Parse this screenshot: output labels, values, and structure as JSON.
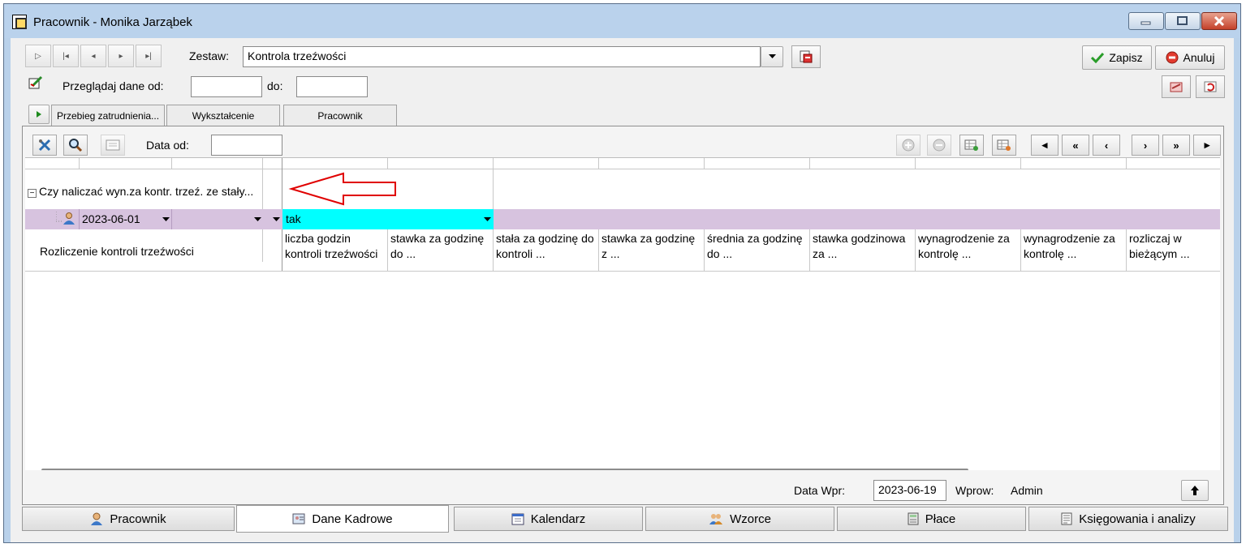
{
  "window": {
    "title": "Pracownik - Monika Jarząbek"
  },
  "toolbar": {
    "zestaw_label": "Zestaw:",
    "zestaw_value": "Kontrola trzeźwości",
    "save_label": "Zapisz",
    "cancel_label": "Anuluj",
    "browse_from_label": "Przeglądaj dane od:",
    "browse_to_label": "do:",
    "browse_from_value": "",
    "browse_to_value": ""
  },
  "tabs": [
    "Przebieg zatrudnienia...",
    "Wykształcenie",
    "Pracownik"
  ],
  "panel": {
    "date_from_label": "Data od:",
    "date_from_value": ""
  },
  "grid": {
    "group_label": "Czy naliczać wyn.za kontr. trzeź. ze stały...",
    "row_date": "2023-06-01",
    "row_value": "tak",
    "row_label": "Rozliczenie kontroli trzeźwości",
    "columns": [
      "liczba godzin kontroli trzeźwości",
      "stawka za godzinę do ...",
      "stała za godzinę do kontroli ...",
      "stawka za godzinę z ...",
      "średnia za godzinę do ...",
      "stawka godzinowa za ...",
      "wynagrodzenie za kontrolę ...",
      "wynagrodzenie za kontrolę ...",
      "rozliczaj w bieżącym ..."
    ]
  },
  "status": {
    "data_wpr_label": "Data Wpr:",
    "data_wpr_value": "2023-06-19",
    "wprow_label": "Wprow:",
    "wprow_value": "Admin"
  },
  "bottom_tabs": [
    "Pracownik",
    "Dane Kadrowe",
    "Kalendarz",
    "Wzorce",
    "Płace",
    "Księgowania i analizy"
  ],
  "colors": {
    "highlight_row": "#d7c3df",
    "selected_cell": "#00ffff",
    "arrow": "#e00000"
  }
}
